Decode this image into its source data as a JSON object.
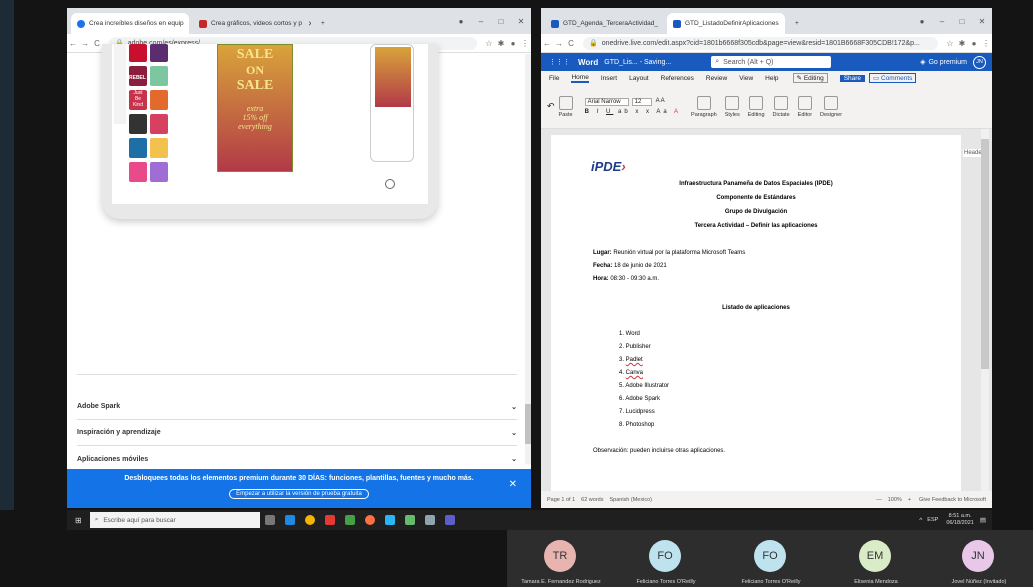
{
  "left_browser": {
    "tabs": [
      {
        "title": "Crea increíbles diseños en equip",
        "favicon_color": "#1a73e8"
      },
      {
        "title": "Crea gráficos, videos cortos y p",
        "favicon_color": "#c62828"
      }
    ],
    "url": "adobe.com/es/express/",
    "accordion": [
      "Adobe Spark",
      "Inspiración y aprendizaje",
      "Aplicaciones móviles"
    ],
    "banner": {
      "text": "Desbloquees todas los elementos premium durante 30 DÍAS: funciones, plantillas, fuentes y mucho más.",
      "button": "Empezar a utilizar la versión de prueba gratuita",
      "bg": "#1473e6"
    },
    "mockup_text": [
      "SALE",
      "ON",
      "SALE",
      "extra",
      "15% off",
      "everything",
      "REBEL",
      "Just",
      "Be",
      "Kind"
    ]
  },
  "right_browser": {
    "tabs": [
      {
        "title": "GTD_Agenda_TerceraActividad_",
        "favicon_color": "#185abd"
      },
      {
        "title": "GTD_ListadoDefinirAplicaciones",
        "favicon_color": "#185abd"
      }
    ],
    "url": "onedrive.live.com/edit.aspx?cid=1801b6668f305cdb&page=view&resid=1801B6668F305CDB!172&p...",
    "word": {
      "app": "Word",
      "doc_title": "GTD_Lis... - Saving...",
      "search": "Search (Alt + Q)",
      "go_premium": "Go premium",
      "user_initials": "JN",
      "menu": [
        "File",
        "Home",
        "Insert",
        "Layout",
        "References",
        "Review",
        "View",
        "Help"
      ],
      "editing": "Editing",
      "share": "Share",
      "comments": "Comments",
      "font": "Arial Narrow",
      "size": "12",
      "ribbon_buttons": [
        "Paste",
        "Paragraph",
        "Styles",
        "Editing",
        "Dictate",
        "Editor",
        "Designer"
      ],
      "ribbon_groups": [
        "Undo",
        "Clipboard",
        "Font",
        "Styles",
        "Dictation",
        "Editor",
        "Designer"
      ],
      "status": {
        "page": "Page 1 of 1",
        "words": "62 words",
        "lang": "Spanish (Mexico)",
        "zoom": "100%",
        "feedback": "Give Feedback to Microsoft"
      },
      "header_label": "Heade"
    },
    "document": {
      "logo": "iPDE",
      "heading": [
        "Infraestructura Panameña de Datos Espaciales (IPDE)",
        "Componente de Estándares",
        "Grupo de Divulgación",
        "Tercera Actividad – Definir las aplicaciones"
      ],
      "lugar_label": "Lugar:",
      "lugar": " Reunión virtual por la plataforma Microsoft Teams",
      "fecha_label": "Fecha:",
      "fecha": " 18 de junio de 2021",
      "hora_label": "Hora:",
      "hora": " 08:30 - 09:30 a.m.",
      "list_title": "Listado de aplicaciones",
      "apps": [
        "Word",
        "Publisher",
        "Padlet",
        "Canva",
        "Adobe Illustrator",
        "Adobe Spark",
        "Lucidpress",
        "Photoshop"
      ],
      "observacion": "Observación: pueden incluirse otras aplicaciones."
    }
  },
  "taskbar": {
    "search_placeholder": "Escribe aquí para buscar",
    "lang": "ESP",
    "time": "8:51 a.m.",
    "date": "06/18/2021"
  },
  "participants": [
    {
      "initials": "TR",
      "name": "Tamara E. Fernandez Rodriguez",
      "color": "#e8b4b0"
    },
    {
      "initials": "FO",
      "name": "Feliciano Torres O'Reilly",
      "color": "#bfe3ee"
    },
    {
      "initials": "FO",
      "name": "Feliciano Torres O'Reilly",
      "color": "#bfe3ee"
    },
    {
      "initials": "EM",
      "name": "Elisenia Mendoza",
      "color": "#d9ecc7"
    },
    {
      "initials": "JN",
      "name": "Jovel Núñez (Invitado)",
      "color": "#e8c7e8"
    }
  ]
}
